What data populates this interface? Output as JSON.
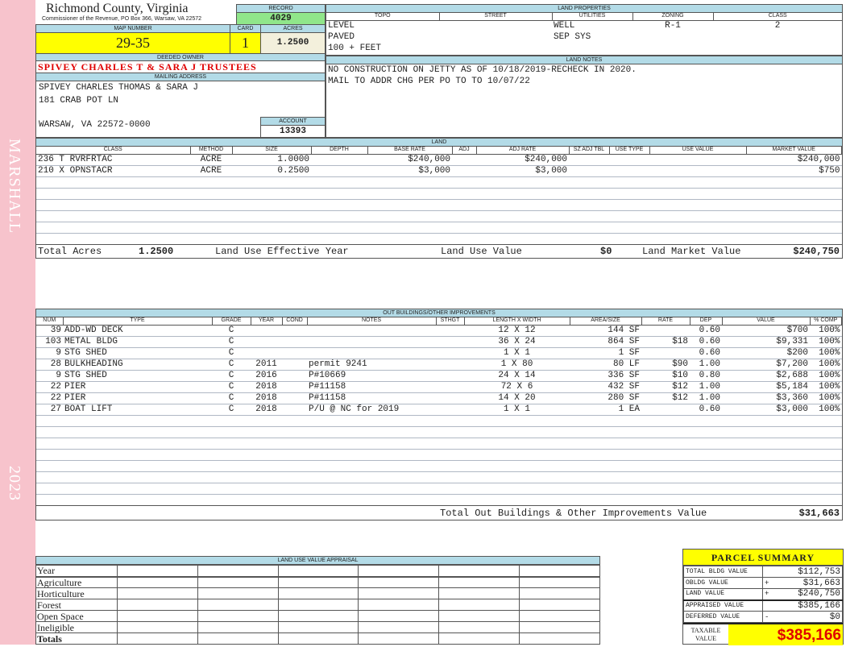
{
  "sidebar": {
    "name": "MARSHALL",
    "year": "2023"
  },
  "header": {
    "county": "Richmond County, Virginia",
    "subtitle": "Commissioner of the Revenue, PO Box 366, Warsaw, VA 22572"
  },
  "record": {
    "label": "RECORD",
    "value": "4029"
  },
  "map": {
    "label": "MAP NUMBER",
    "value": "29-35"
  },
  "card": {
    "label": "CARD",
    "value": "1"
  },
  "acres": {
    "label": "ACRES",
    "value": "1.2500"
  },
  "owner": {
    "label": "DEEDED OWNER",
    "value": "SPIVEY CHARLES T & SARA J TRUSTEES"
  },
  "mailing": {
    "label": "MAILING ADDRESS",
    "line1": "SPIVEY CHARLES THOMAS & SARA J",
    "line2": "181 CRAB POT LN",
    "line3": "WARSAW, VA 22572-0000"
  },
  "account": {
    "label": "ACCOUNT",
    "value": "13393"
  },
  "land_properties": {
    "label": "LAND PROPERTIES",
    "columns": [
      "TOPO",
      "STREET",
      "UTILITIES",
      "ZONING",
      "CLASS"
    ],
    "topo": [
      "LEVEL",
      "PAVED",
      "100 + FEET"
    ],
    "utilities": [
      "WELL",
      "SEP SYS"
    ],
    "zoning": "R-1",
    "class": "2"
  },
  "land_notes": {
    "label": "LAND NOTES",
    "lines": [
      "NO CONSTRUCTION ON JETTY AS OF 10/18/2019-RECHECK IN 2020.",
      "MAIL TO ADDR CHG PER PO TO TO 10/07/22"
    ]
  },
  "land": {
    "label": "LAND",
    "columns": [
      "CLASS",
      "METHOD",
      "SIZE",
      "DEPTH",
      "BASE RATE",
      "ADJ",
      "ADJ RATE",
      "SZ ADJ TBL",
      "USE TYPE",
      "USE VALUE",
      "MARKET VALUE"
    ],
    "rows": [
      [
        "236 T RVRFRTAC",
        "ACRE",
        "1.0000",
        "",
        "$240,000",
        "",
        "$240,000",
        "",
        "",
        "",
        "$240,000"
      ],
      [
        "210 X OPNSTACR",
        "ACRE",
        "0.2500",
        "",
        "$3,000",
        "",
        "$3,000",
        "",
        "",
        "",
        "$750"
      ]
    ],
    "totals": {
      "acres_label": "Total Acres",
      "acres": "1.2500",
      "effective_label": "Land Use Effective Year",
      "use_label": "Land Use Value",
      "use_value": "$0",
      "market_label": "Land Market Value",
      "market_value": "$240,750"
    }
  },
  "outbuildings": {
    "label": "OUT BUILDINGS/OTHER IMPROVEMENTS",
    "columns": [
      "NUM",
      "TYPE",
      "GRADE",
      "YEAR",
      "COND",
      "NOTES",
      "STHGT",
      "LENGTH X WIDTH",
      "AREA/SIZE",
      "RATE",
      "DEP",
      "VALUE",
      "% COMP"
    ],
    "rows": [
      [
        "39",
        "ADD-WD DECK",
        "C",
        "",
        "",
        "",
        "",
        "12 X 12",
        "144 SF",
        "",
        "0.60",
        "$700",
        "100%"
      ],
      [
        "103",
        "METAL BLDG",
        "C",
        "",
        "",
        "",
        "",
        "36 X 24",
        "864 SF",
        "$18",
        "0.60",
        "$9,331",
        "100%"
      ],
      [
        "9",
        "STG SHED",
        "C",
        "",
        "",
        "",
        "",
        "1 X 1",
        "1 SF",
        "",
        "0.60",
        "$200",
        "100%"
      ],
      [
        "28",
        "BULKHEADING",
        "C",
        "2011",
        "",
        "permit 9241",
        "",
        "1 X 80",
        "80 LF",
        "$90",
        "1.00",
        "$7,200",
        "100%"
      ],
      [
        "9",
        "STG SHED",
        "C",
        "2016",
        "",
        "P#10669",
        "",
        "24 X 14",
        "336 SF",
        "$10",
        "0.80",
        "$2,688",
        "100%"
      ],
      [
        "22",
        "PIER",
        "C",
        "2018",
        "",
        "P#11158",
        "",
        "72 X 6",
        "432 SF",
        "$12",
        "1.00",
        "$5,184",
        "100%"
      ],
      [
        "22",
        "PIER",
        "C",
        "2018",
        "",
        "P#11158",
        "",
        "14 X 20",
        "280 SF",
        "$12",
        "1.00",
        "$3,360",
        "100%"
      ],
      [
        "27",
        "BOAT LIFT",
        "C",
        "2018",
        "",
        "P/U @ NC for 2019",
        "",
        "1 X 1",
        "1 EA",
        "",
        "0.60",
        "$3,000",
        "100%"
      ]
    ],
    "total_label": "Total Out Buildings & Other Improvements Value",
    "total": "$31,663"
  },
  "land_use": {
    "label": "LAND USE VALUE APPRAISAL",
    "rows": [
      "Year",
      "Agriculture",
      "Horticulture",
      "Forest",
      "Open Space",
      "Ineligible",
      "Totals"
    ]
  },
  "summary": {
    "title": "PARCEL SUMMARY",
    "rows": [
      {
        "label": "TOTAL BLDG VALUE",
        "op": "",
        "value": "$112,753"
      },
      {
        "label": "OBLDG VALUE",
        "op": "+",
        "value": "$31,663"
      },
      {
        "label": "LAND VALUE",
        "op": "+",
        "value": "$240,750"
      },
      {
        "label": "APPRAISED VALUE",
        "op": "",
        "value": "$385,166"
      },
      {
        "label": "DEFERRED VALUE",
        "op": "-",
        "value": "$0"
      }
    ],
    "taxable_label": "TAXABLE VALUE",
    "taxable": "$385,166"
  }
}
